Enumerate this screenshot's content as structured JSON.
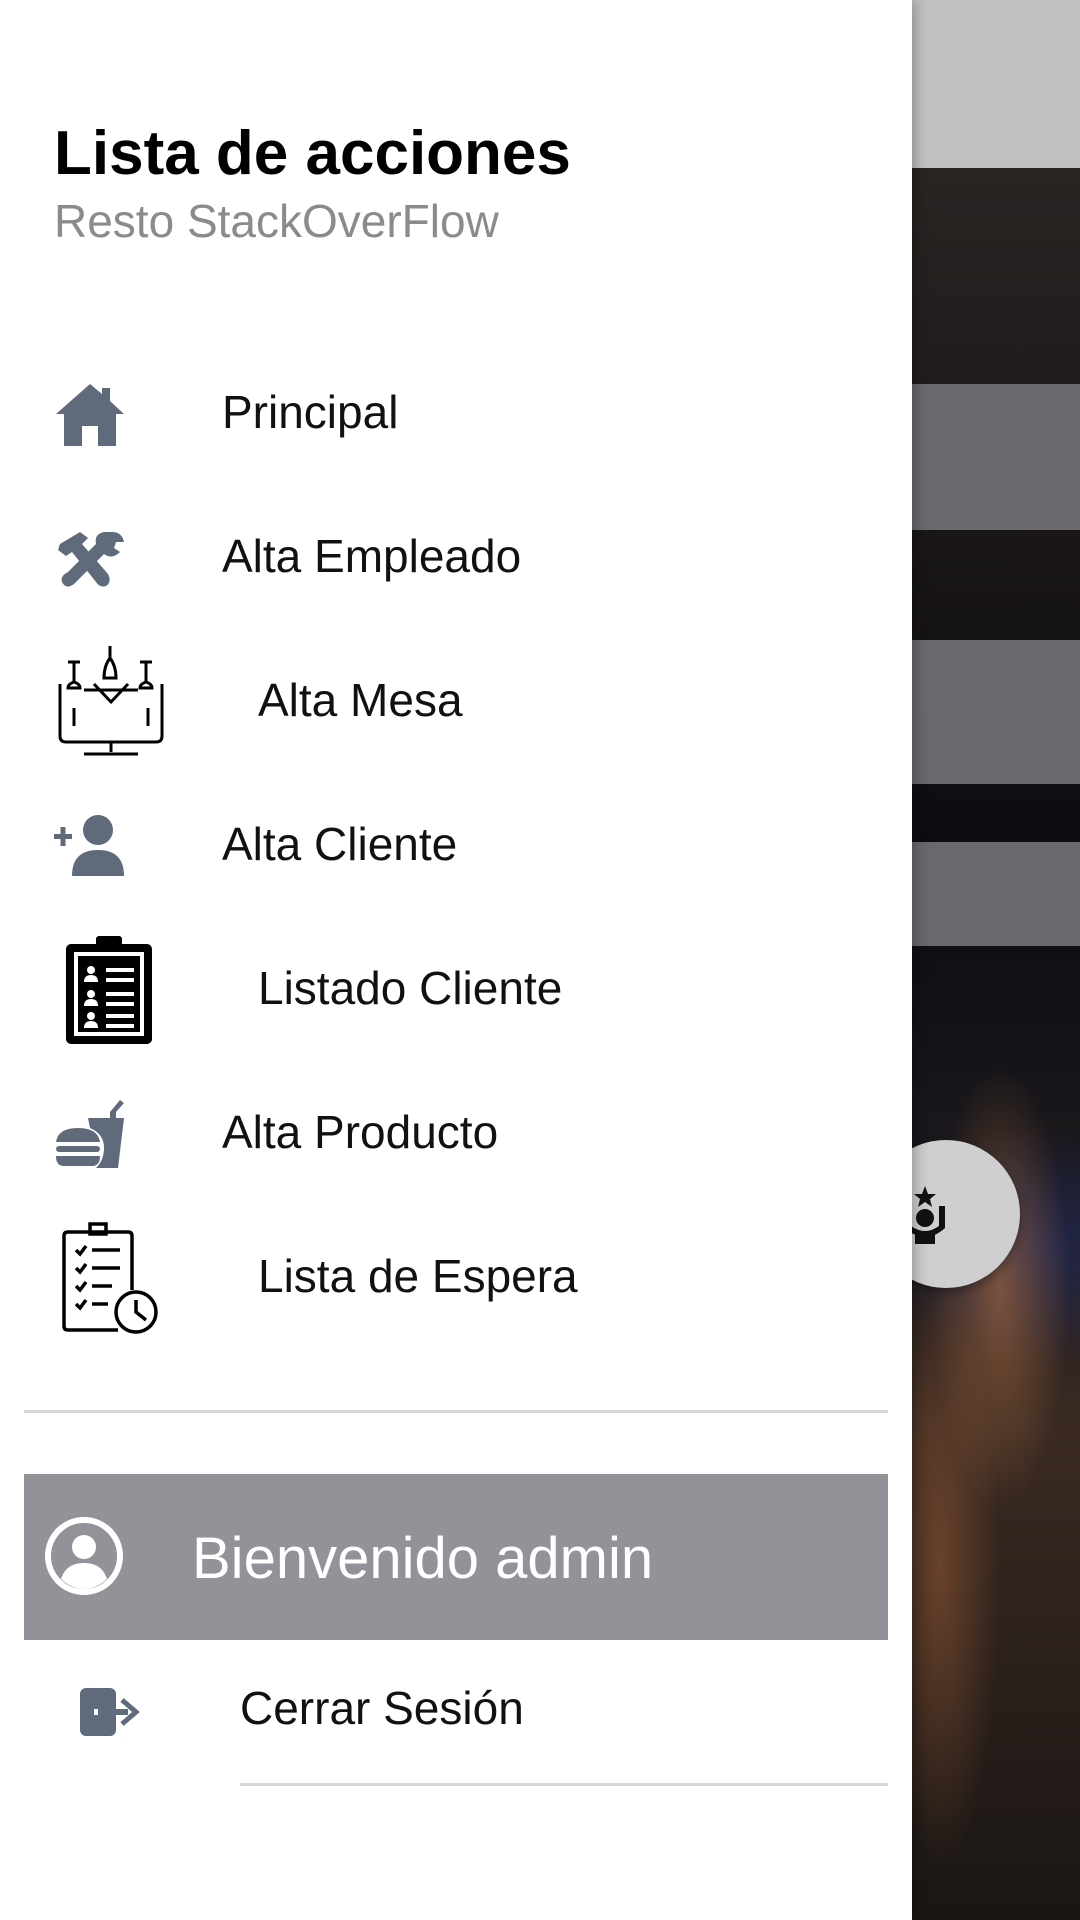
{
  "drawer": {
    "title": "Lista de acciones",
    "subtitle": "Resto StackOverFlow",
    "items": [
      {
        "label": "Principal",
        "icon": "home-icon"
      },
      {
        "label": "Alta Empleado",
        "icon": "tools-icon"
      },
      {
        "label": "Alta Mesa",
        "icon": "restaurant-table-icon"
      },
      {
        "label": "Alta Cliente",
        "icon": "add-user-icon"
      },
      {
        "label": "Listado Cliente",
        "icon": "clipboard-list-icon"
      },
      {
        "label": "Alta Producto",
        "icon": "fast-food-icon"
      },
      {
        "label": "Lista de Espera",
        "icon": "waiting-list-icon"
      }
    ],
    "welcome": {
      "text": "Bienvenido admin",
      "icon": "account-circle-icon"
    },
    "logout": {
      "label": "Cerrar Sesión",
      "icon": "logout-icon"
    }
  },
  "colors": {
    "icon_gray": "#5f6a7b",
    "welcome_bg": "#919399",
    "subtitle": "#8b8b8e"
  },
  "background": {
    "fab_icon": "chef-icon"
  }
}
